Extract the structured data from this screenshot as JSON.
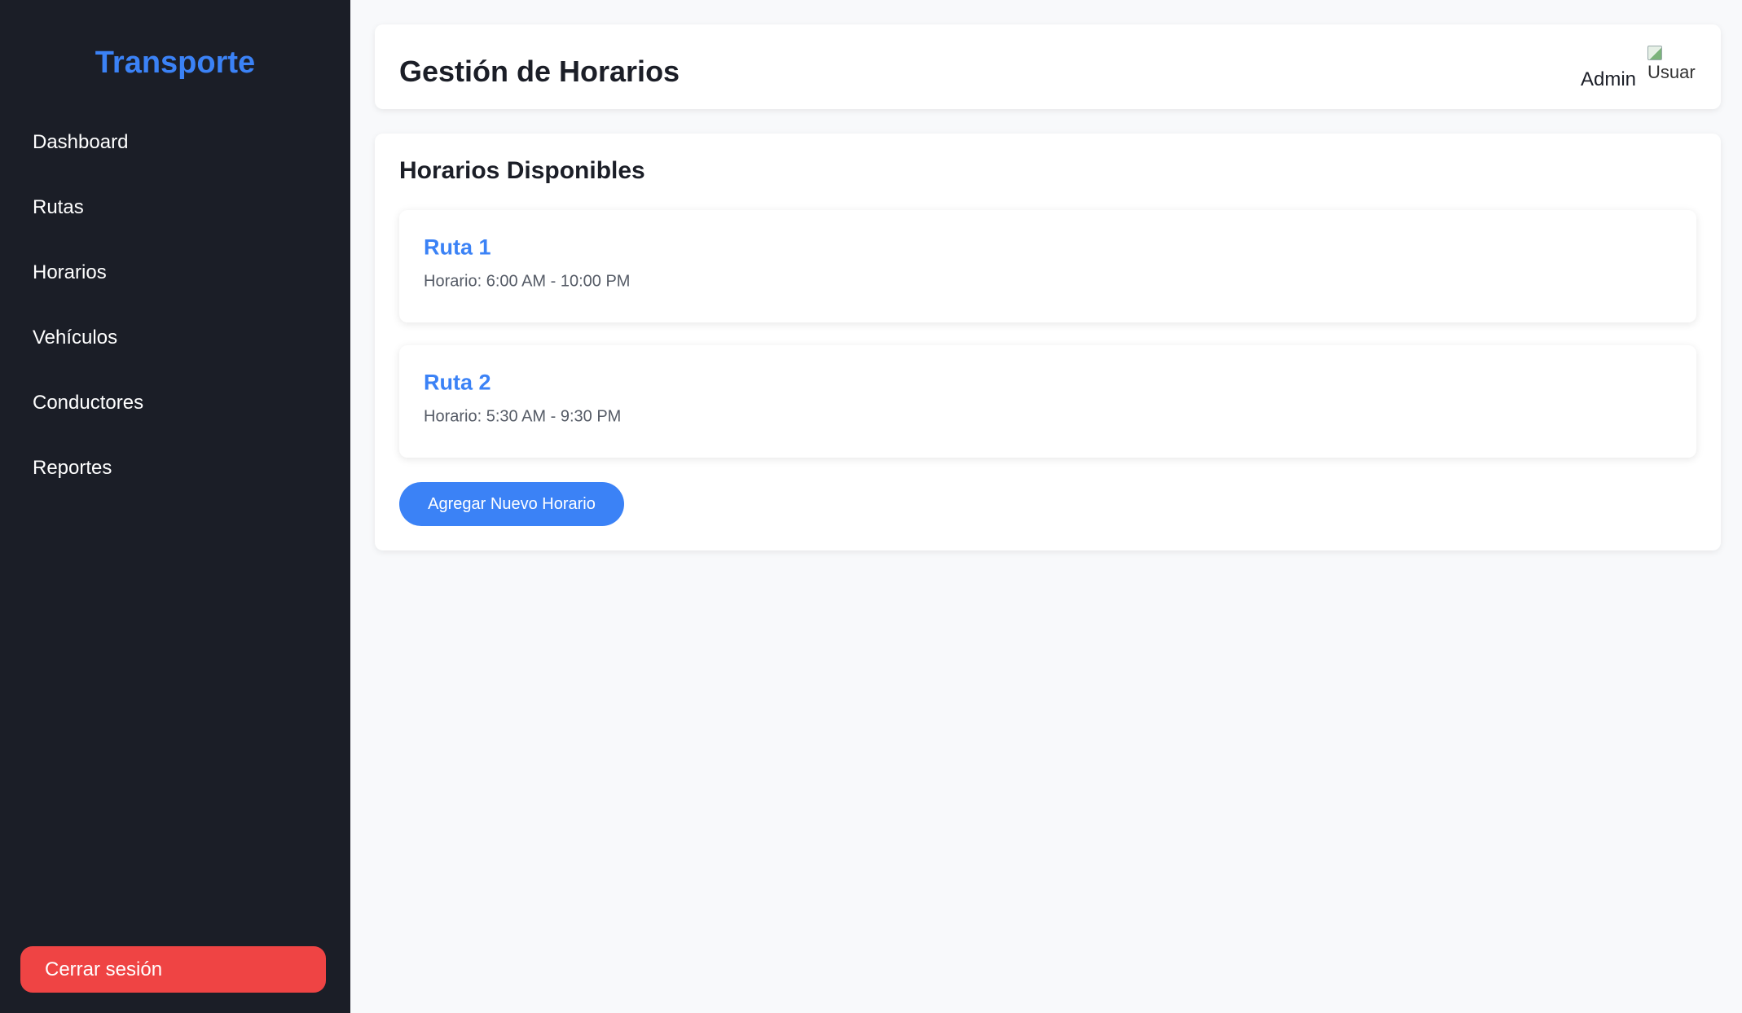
{
  "sidebar": {
    "brand": "Transporte",
    "items": [
      {
        "label": "Dashboard"
      },
      {
        "label": "Rutas"
      },
      {
        "label": "Horarios"
      },
      {
        "label": "Vehículos"
      },
      {
        "label": "Conductores"
      },
      {
        "label": "Reportes"
      }
    ],
    "logout_label": "Cerrar sesión"
  },
  "header": {
    "title": "Gestión de Horarios",
    "user_name": "Admin",
    "avatar_alt": "Usuario"
  },
  "main": {
    "section_title": "Horarios Disponibles",
    "routes": [
      {
        "name": "Ruta 1",
        "schedule": "Horario: 6:00 AM - 10:00 PM"
      },
      {
        "name": "Ruta 2",
        "schedule": "Horario: 5:30 AM - 9:30 PM"
      }
    ],
    "add_button_label": "Agregar Nuevo Horario"
  },
  "colors": {
    "accent": "#3b82f6",
    "sidebar_bg": "#1b1e27",
    "danger": "#ef4444",
    "page_bg": "#f8f9fb"
  }
}
